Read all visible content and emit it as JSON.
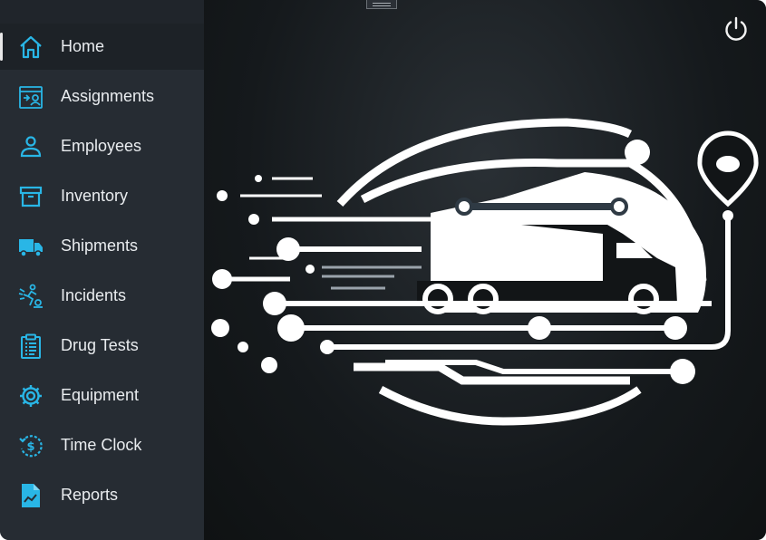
{
  "sidebar": {
    "items": [
      {
        "label": "Home",
        "icon": "home-icon",
        "active": true
      },
      {
        "label": "Assignments",
        "icon": "assignments-icon",
        "active": false
      },
      {
        "label": "Employees",
        "icon": "employee-icon",
        "active": false
      },
      {
        "label": "Inventory",
        "icon": "archive-box-icon",
        "active": false
      },
      {
        "label": "Shipments",
        "icon": "truck-icon",
        "active": false
      },
      {
        "label": "Incidents",
        "icon": "incident-icon",
        "active": false
      },
      {
        "label": "Drug Tests",
        "icon": "clipboard-icon",
        "active": false
      },
      {
        "label": "Equipment",
        "icon": "gear-icon",
        "active": false
      },
      {
        "label": "Time Clock",
        "icon": "clock-dollar-icon",
        "active": false
      },
      {
        "label": "Reports",
        "icon": "report-icon",
        "active": false
      }
    ]
  },
  "colors": {
    "accent": "#29b6e6",
    "sidebar_bg": "#262c33",
    "active_item_bg": "#1d2227",
    "main_bg": "#15191c"
  },
  "header": {
    "power_icon": "power-icon",
    "drag_icon": "drag-handle-icon"
  },
  "main": {
    "logo": "truck-circuit-logo"
  }
}
